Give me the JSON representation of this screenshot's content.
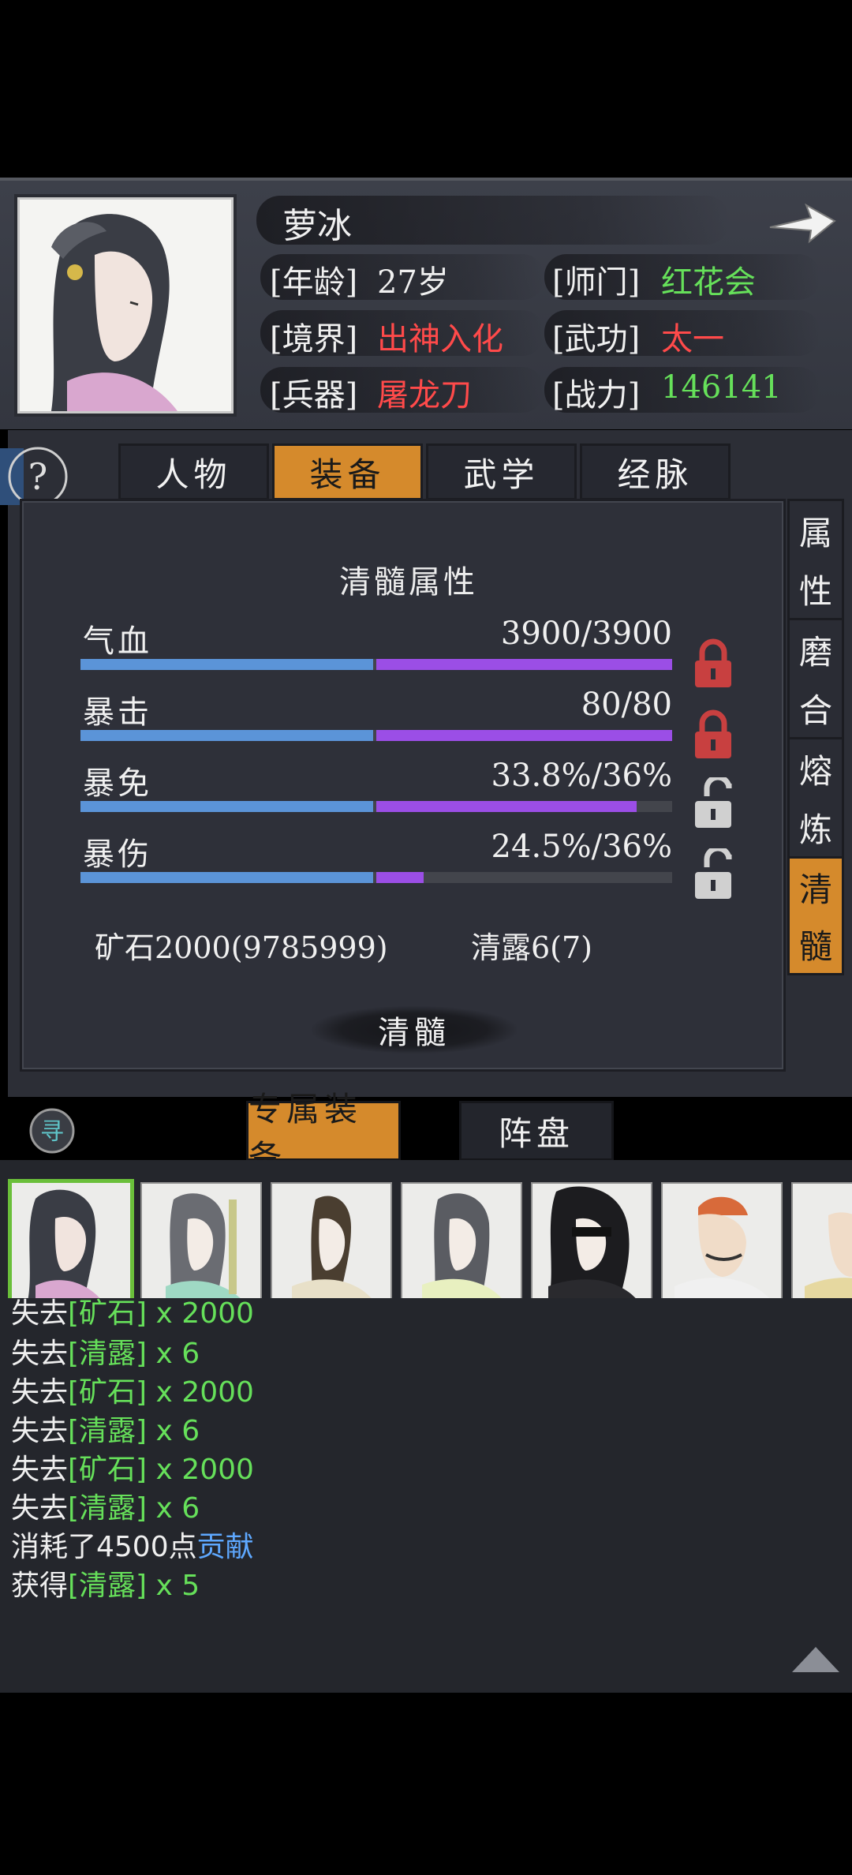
{
  "character": {
    "name": "萝冰",
    "age_label": "[年龄]",
    "age_value": "27岁",
    "sect_label": "[师门]",
    "sect_value": "红花会",
    "realm_label": "[境界]",
    "realm_value": "出神入化",
    "kungfu_label": "[武功]",
    "kungfu_value": "太一",
    "weapon_label": "[兵器]",
    "weapon_value": "屠龙刀",
    "power_label": "[战力]",
    "power_value": "146141"
  },
  "main_tabs": [
    {
      "label": "人物",
      "active": false
    },
    {
      "label": "装备",
      "active": true
    },
    {
      "label": "武学",
      "active": false
    },
    {
      "label": "经脉",
      "active": false
    }
  ],
  "side_tabs": [
    {
      "c1": "属",
      "c2": "性",
      "active": false
    },
    {
      "c1": "磨",
      "c2": "合",
      "active": false
    },
    {
      "c1": "熔",
      "c2": "炼",
      "active": false
    },
    {
      "c1": "清",
      "c2": "髓",
      "active": true
    }
  ],
  "refine": {
    "title": "清髓属性",
    "stats": [
      {
        "label": "气血",
        "value": "3900/3900",
        "blue_fill": 0.5,
        "purple_fill": 0.5,
        "locked": true
      },
      {
        "label": "暴击",
        "value": "80/80",
        "blue_fill": 0.5,
        "purple_fill": 0.5,
        "locked": true
      },
      {
        "label": "暴免",
        "value": "33.8%/36%",
        "blue_fill": 0.5,
        "purple_fill": 0.44,
        "locked": false
      },
      {
        "label": "暴伤",
        "value": "24.5%/36%",
        "blue_fill": 0.5,
        "purple_fill": 0.08,
        "locked": false
      }
    ],
    "ore_text": "矿石2000(9785999)",
    "dew_text": "清露6(7)",
    "button_label": "清髓"
  },
  "bottom_tabs": [
    {
      "label": "专属装备",
      "active": true
    },
    {
      "label": "阵盘",
      "active": false
    }
  ],
  "search_glyph": "寻",
  "log": [
    {
      "a": "失去",
      "b": "[矿石]",
      "c": " x 2000",
      "style": "green"
    },
    {
      "a": "失去",
      "b": "[清露]",
      "c": " x 6",
      "style": "green"
    },
    {
      "a": "失去",
      "b": "[矿石]",
      "c": " x 2000",
      "style": "green"
    },
    {
      "a": "失去",
      "b": "[清露]",
      "c": " x 6",
      "style": "green"
    },
    {
      "a": "失去",
      "b": "[矿石]",
      "c": " x 2000",
      "style": "green"
    },
    {
      "a": "失去",
      "b": "[清露]",
      "c": " x 6",
      "style": "green"
    },
    {
      "a": "消耗了4500点",
      "b": "贡献",
      "c": "",
      "style": "blue"
    },
    {
      "a": "获得",
      "b": "[清露]",
      "c": " x 5",
      "style": "green"
    }
  ],
  "colors": {
    "accent_orange": "#d58a2c",
    "value_red": "#ff4a4a",
    "value_green": "#66e05a",
    "bar_blue": "#5b94d8",
    "bar_purple": "#9b4ee6",
    "lock_red": "#c84040",
    "lock_gray": "#d0d0d0"
  }
}
